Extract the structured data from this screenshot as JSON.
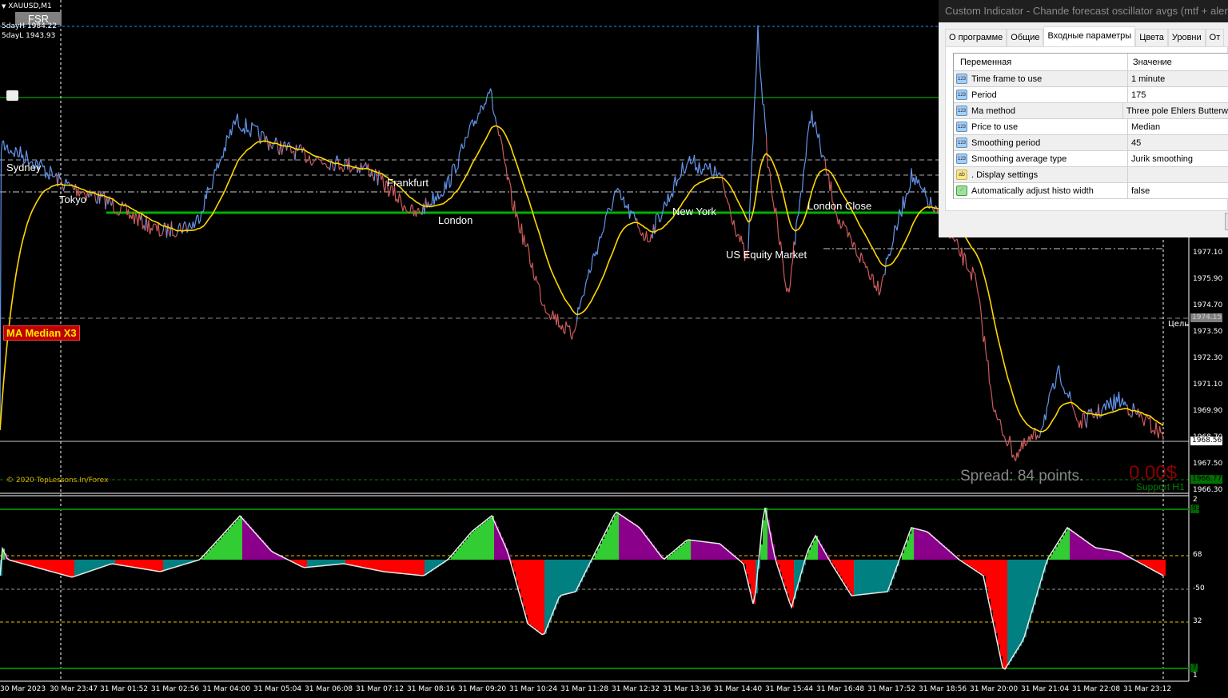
{
  "chart": {
    "symbol": "XAUUSD,M1",
    "fsr_label": "FSR",
    "five_day_high": "5dayH 1984.22",
    "five_day_low": "5dayL 1943.93",
    "ma_label": "MA Median X3",
    "copyright": "© 2020 TopLessons.In/Forex",
    "spread": "Spread: 84 points.",
    "profit": "0.00$",
    "support": "Support H1",
    "target_label": "Цель",
    "sessions": [
      "Sydney",
      "Tokyo",
      "Frankfurt",
      "London",
      "New York",
      "US Equity Market",
      "London Close"
    ],
    "colors": {
      "up": "#6495ed",
      "down": "#cd5c5c",
      "ma": "#ffd700",
      "level": "#00c000"
    }
  },
  "price_axis": {
    "labels": [
      "1977.10",
      "1975.90",
      "1974.70",
      "1973.50",
      "1972.30",
      "1971.10",
      "1969.90",
      "1968.70",
      "1967.50",
      "1966.30"
    ],
    "target_price": "1974.15",
    "current_price": "1968.56",
    "support_price": "1966.77"
  },
  "indicator_axis": {
    "labels": [
      "2",
      "68",
      "-50",
      "32",
      "1"
    ],
    "upper_level": "93",
    "lower_level": "7"
  },
  "time_axis": [
    "30 Mar 2023",
    "30 Mar 23:47",
    "31 Mar 01:52",
    "31 Mar 02:56",
    "31 Mar 04:00",
    "31 Mar 05:04",
    "31 Mar 06:08",
    "31 Mar 07:12",
    "31 Mar 08:16",
    "31 Mar 09:20",
    "31 Mar 10:24",
    "31 Mar 11:28",
    "31 Mar 12:32",
    "31 Mar 13:36",
    "31 Mar 14:40",
    "31 Mar 15:44",
    "31 Mar 16:48",
    "31 Mar 17:52",
    "31 Mar 18:56",
    "31 Mar 20:00",
    "31 Mar 21:04",
    "31 Mar 22:08",
    "31 Mar 23:12"
  ],
  "chart_data": {
    "type": "line",
    "x_unit": "minutes from 30 Mar 23:47",
    "price": [
      [
        -121,
        1982.08
      ],
      [
        -43,
        1981.35
      ],
      [
        35,
        1980.26
      ],
      [
        133,
        1979.54
      ],
      [
        270,
        1978.08
      ],
      [
        357,
        1978.45
      ],
      [
        455,
        1983.17
      ],
      [
        543,
        1982.08
      ],
      [
        660,
        1981.35
      ],
      [
        777,
        1980.99
      ],
      [
        894,
        1978.81
      ],
      [
        973,
        1980.26
      ],
      [
        1074,
        1984.63
      ],
      [
        1129,
        1979.54
      ],
      [
        1207,
        1974.81
      ],
      [
        1275,
        1973.35
      ],
      [
        1324,
        1976.63
      ],
      [
        1383,
        1979.9
      ],
      [
        1461,
        1977.72
      ],
      [
        1558,
        1981.35
      ],
      [
        1637,
        1980.63
      ],
      [
        1705,
        1976.63
      ],
      [
        1730,
        1987.17
      ],
      [
        1754,
        1981.35
      ],
      [
        1803,
        1975.17
      ],
      [
        1861,
        1983.54
      ],
      [
        1930,
        1978.45
      ],
      [
        2027,
        1975.54
      ],
      [
        2105,
        1980.63
      ],
      [
        2183,
        1978.45
      ],
      [
        2262,
        1975.9
      ],
      [
        2310,
        1969.72
      ],
      [
        2359,
        1967.9
      ],
      [
        2418,
        1968.99
      ],
      [
        2467,
        1971.72
      ],
      [
        2515,
        1969.35
      ],
      [
        2613,
        1970.45
      ],
      [
        2721,
        1968.81
      ]
    ],
    "oscillator": [
      [
        -121,
        74.4
      ],
      [
        -102,
        65.8
      ],
      [
        55,
        56.3
      ],
      [
        152,
        63.6
      ],
      [
        270,
        59.3
      ],
      [
        367,
        65.8
      ],
      [
        465,
        89.5
      ],
      [
        543,
        70.1
      ],
      [
        621,
        61.5
      ],
      [
        719,
        63.6
      ],
      [
        816,
        59.3
      ],
      [
        914,
        57.1
      ],
      [
        973,
        65.8
      ],
      [
        1031,
        80.9
      ],
      [
        1080,
        89.5
      ],
      [
        1119,
        70.1
      ],
      [
        1168,
        31.2
      ],
      [
        1207,
        24.7
      ],
      [
        1246,
        46.3
      ],
      [
        1285,
        48.5
      ],
      [
        1324,
        65.8
      ],
      [
        1383,
        91.7
      ],
      [
        1441,
        83.1
      ],
      [
        1500,
        65.8
      ],
      [
        1558,
        76.6
      ],
      [
        1637,
        74.4
      ],
      [
        1695,
        63.6
      ],
      [
        1721,
        39.8
      ],
      [
        1746,
        96.0
      ],
      [
        1773,
        65.8
      ],
      [
        1812,
        39.8
      ],
      [
        1851,
        70.1
      ],
      [
        1871,
        78.7
      ],
      [
        1910,
        63.6
      ],
      [
        1959,
        46.3
      ],
      [
        2047,
        48.5
      ],
      [
        2105,
        83.1
      ],
      [
        2144,
        80.9
      ],
      [
        2222,
        65.8
      ],
      [
        2281,
        57.1
      ],
      [
        2330,
        5.3
      ],
      [
        2379,
        22.6
      ],
      [
        2437,
        65.8
      ],
      [
        2486,
        83.1
      ],
      [
        2554,
        72.3
      ],
      [
        2613,
        70.1
      ],
      [
        2721,
        57.1
      ]
    ]
  },
  "dialog": {
    "title": "Custom Indicator - Chande forecast oscillator avgs (mtf + alerts)",
    "tabs": [
      "О программе",
      "Общие",
      "Входные параметры",
      "Цвета",
      "Уровни",
      "От"
    ],
    "columns": [
      "Переменная",
      "Значение"
    ],
    "rows": [
      {
        "icon": "123",
        "name": "Time frame to use",
        "value": "1 minute"
      },
      {
        "icon": "123",
        "name": "Period",
        "value": "175"
      },
      {
        "icon": "123",
        "name": "Ma method",
        "value": "Three pole Ehlers Butterw"
      },
      {
        "icon": "123",
        "name": "Price to use",
        "value": "Median"
      },
      {
        "icon": "123",
        "name": "Smoothing period",
        "value": "45"
      },
      {
        "icon": "123",
        "name": "Smoothing average type",
        "value": "Jurik smoothing"
      },
      {
        "icon": "ab",
        "name": ". Display settings",
        "value": ""
      },
      {
        "icon": "bool",
        "name": "Automatically adjust histo width",
        "value": "false"
      }
    ]
  }
}
